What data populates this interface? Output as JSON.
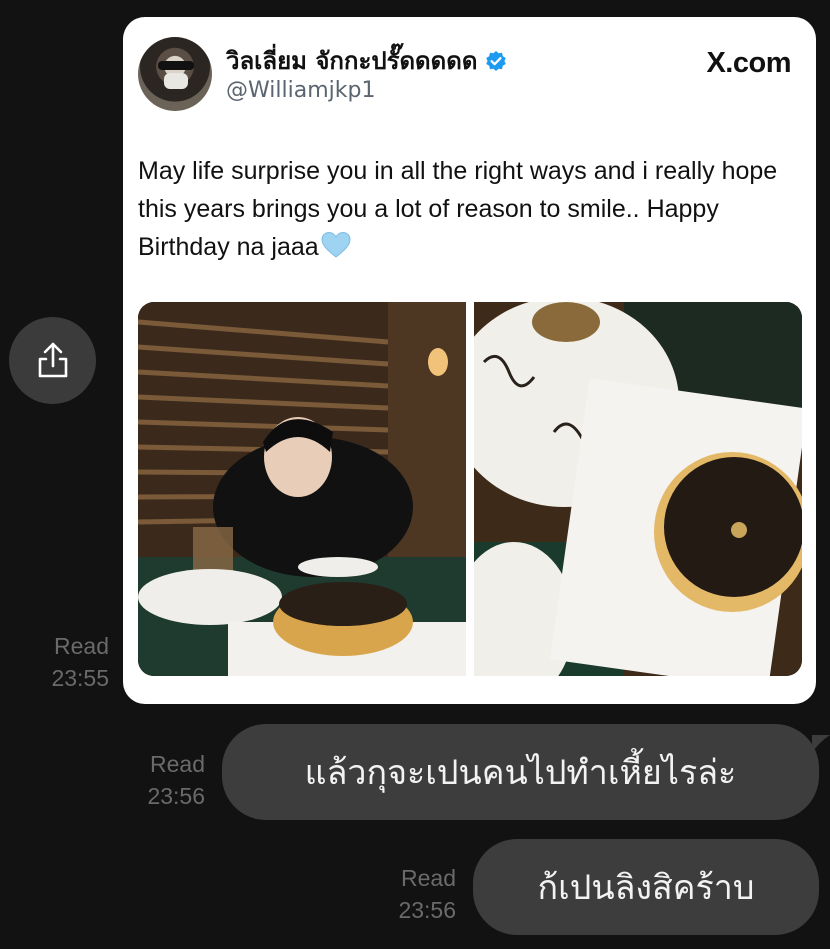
{
  "share_button": {
    "icon": "share-icon"
  },
  "tweet": {
    "author_name": "วิลเลี่ยม จักกะปรั๊ดดดดด",
    "handle": "@Williamjkp1",
    "source": "X.com",
    "text": "May life surprise you in all the right ways and i really hope this years brings you a lot of reason to smile.. Happy Birthday na jaaa",
    "emoji": "light-blue-heart",
    "verified_color": "#1d9bf0"
  },
  "messages": [
    {
      "read_label": "Read",
      "time": "23:55"
    },
    {
      "read_label": "Read",
      "time": "23:56",
      "text": "แล้วกุจะเปนคนไปทำเหี้ยไรล่ะ"
    },
    {
      "read_label": "Read",
      "time": "23:56",
      "text": "ก้เปนลิงสิคร้าบ"
    }
  ]
}
